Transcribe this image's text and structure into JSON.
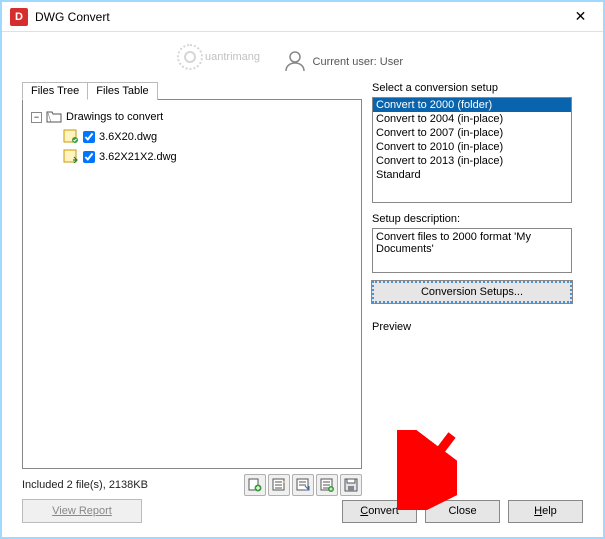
{
  "titlebar": {
    "title": "DWG Convert"
  },
  "user": {
    "label": "Current user: User"
  },
  "tabs": {
    "tree": "Files Tree",
    "table": "Files Table"
  },
  "tree": {
    "root": "Drawings to convert",
    "files": [
      {
        "name": "3.6X20.dwg"
      },
      {
        "name": "3.62X21X2.dwg"
      }
    ]
  },
  "status": {
    "text": "Included 2 file(s), 2138KB"
  },
  "setup": {
    "label": "Select a conversion setup",
    "options": [
      "Convert to 2000 (folder)",
      "Convert to 2004 (in-place)",
      "Convert to 2007 (in-place)",
      "Convert to 2010 (in-place)",
      "Convert to 2013 (in-place)",
      "Standard"
    ],
    "selected_index": 0,
    "desc_label": "Setup description:",
    "description": "Convert files to 2000 format 'My Documents'",
    "button": "Conversion Setups..."
  },
  "preview": {
    "label": "Preview"
  },
  "buttons": {
    "view_report": "View Report",
    "convert": "Convert",
    "convert_u": "C",
    "close": "Close",
    "help": "Help",
    "help_u": "H"
  },
  "watermark": "uantrimang"
}
